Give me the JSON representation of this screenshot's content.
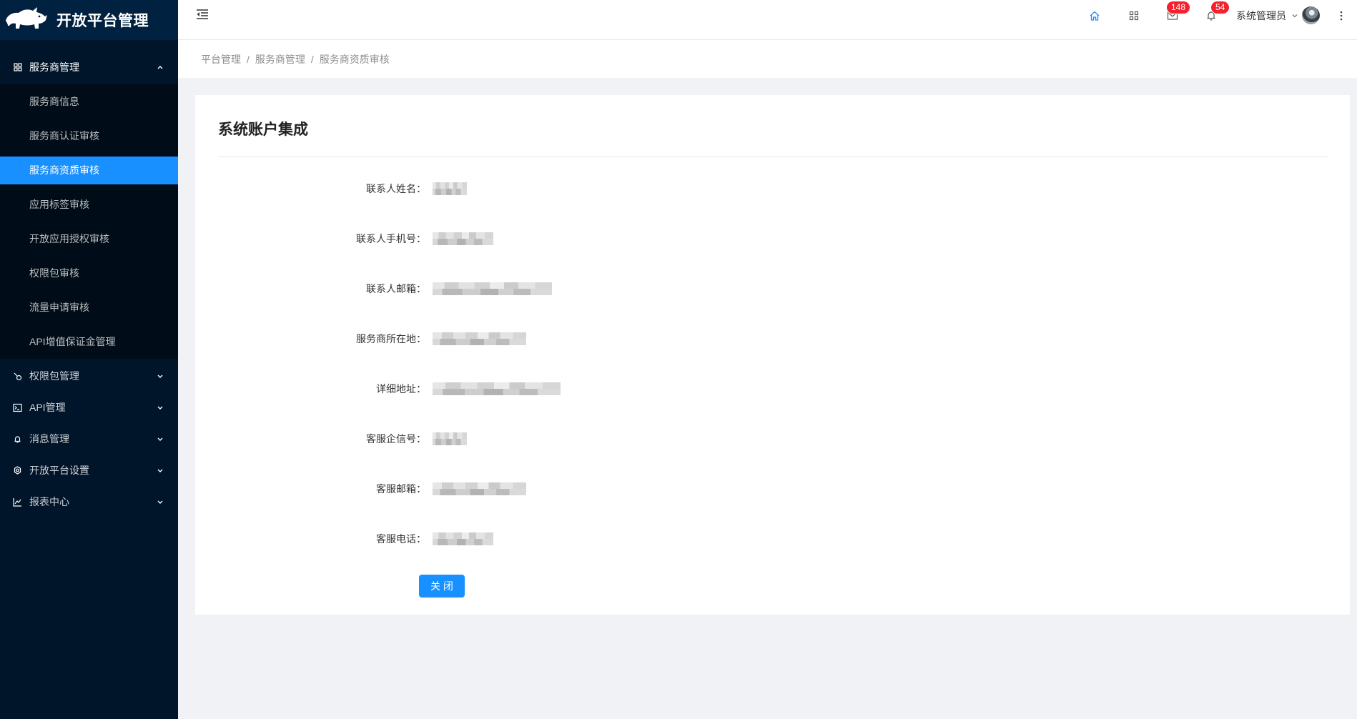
{
  "theme": {
    "sidebar-bg": "#001529",
    "logo-bg": "#002140",
    "submenu-bg": "#000c17",
    "accent": "#1890ff",
    "badge": "#f5222d",
    "page-bg": "#f0f2f5"
  },
  "app": {
    "title": "开放平台管理",
    "logo_icon": "rhino-logo-icon"
  },
  "sidebar": {
    "expanded_group": {
      "label": "服务商管理",
      "icon": "appstore-icon",
      "items": [
        {
          "label": "服务商信息",
          "active": false
        },
        {
          "label": "服务商认证审核",
          "active": false
        },
        {
          "label": "服务商资质审核",
          "active": true
        },
        {
          "label": "应用标签审核",
          "active": false
        },
        {
          "label": "开放应用授权审核",
          "active": false
        },
        {
          "label": "权限包审核",
          "active": false
        },
        {
          "label": "流量申请审核",
          "active": false
        },
        {
          "label": "API增值保证金管理",
          "active": false
        }
      ]
    },
    "collapsed_groups": [
      {
        "label": "权限包管理",
        "icon": "link-icon"
      },
      {
        "label": "API管理",
        "icon": "code-icon"
      },
      {
        "label": "消息管理",
        "icon": "bell-icon"
      },
      {
        "label": "开放平台设置",
        "icon": "gear-icon"
      },
      {
        "label": "报表中心",
        "icon": "line-chart-icon"
      }
    ]
  },
  "header": {
    "icons": [
      "menu-fold-icon",
      "home-icon",
      "appstore-icon",
      "mail-icon",
      "bell-icon",
      "more-icon"
    ],
    "mail_badge": "148",
    "notification_badge": "54",
    "user_name": "系统管理员"
  },
  "breadcrumb": {
    "items": [
      "平台管理",
      "服务商管理",
      "服务商资质审核"
    ],
    "separator": "/"
  },
  "main": {
    "title": "系统账户集成",
    "fields": [
      {
        "label": "联系人姓名："
      },
      {
        "label": "联系人手机号："
      },
      {
        "label": "联系人邮箱："
      },
      {
        "label": "服务商所在地："
      },
      {
        "label": "详细地址："
      },
      {
        "label": "客服企信号："
      },
      {
        "label": "客服邮箱："
      },
      {
        "label": "客服电话："
      }
    ],
    "close_button": "关 闭"
  }
}
